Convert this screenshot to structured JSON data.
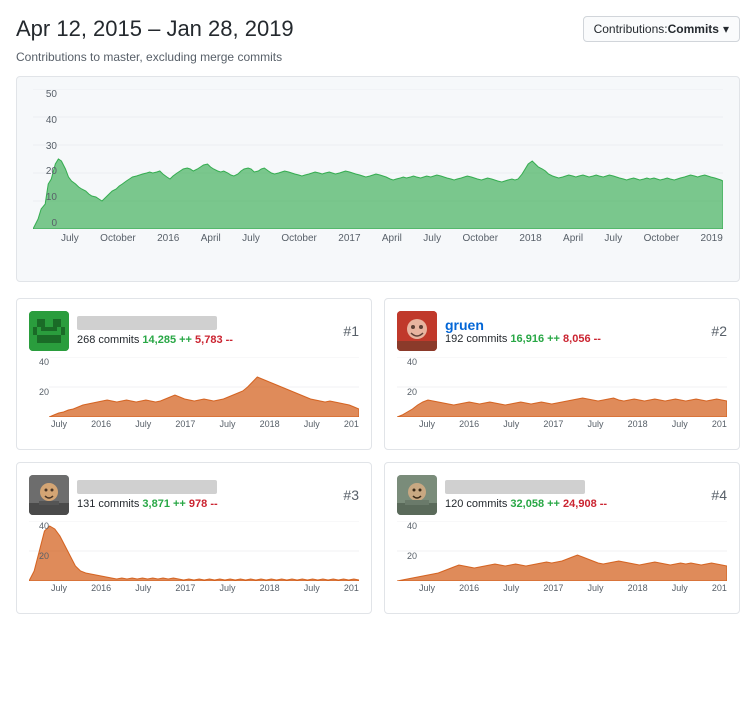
{
  "header": {
    "date_range": "Apr 12, 2015 – Jan 28, 2019",
    "contributions_label": "Contributions: ",
    "contributions_type": "Commits",
    "caret": "▾"
  },
  "subtitle": "Contributions to master, excluding merge commits",
  "main_chart": {
    "y_labels": [
      "50",
      "40",
      "30",
      "20",
      "10",
      "0"
    ],
    "x_labels": [
      "July",
      "October",
      "2016",
      "April",
      "July",
      "October",
      "2017",
      "April",
      "July",
      "October",
      "2018",
      "April",
      "July",
      "October",
      "2019"
    ]
  },
  "contributors": [
    {
      "rank": "#1",
      "name_hidden": true,
      "name": "",
      "commits": "268 commits",
      "additions": "14,285 ++",
      "deletions": "5,783 --",
      "x_labels": [
        "July",
        "2016",
        "July",
        "2017",
        "July",
        "2018",
        "July",
        "201"
      ],
      "avatar_type": "green-pixel"
    },
    {
      "rank": "#2",
      "name_hidden": false,
      "name": "gruen",
      "commits": "192 commits",
      "additions": "16,916 ++",
      "deletions": "8,056 --",
      "x_labels": [
        "July",
        "2016",
        "July",
        "2017",
        "July",
        "2018",
        "July",
        "201"
      ],
      "avatar_type": "red-face"
    },
    {
      "rank": "#3",
      "name_hidden": true,
      "name": "",
      "commits": "131 commits",
      "additions": "3,871 ++",
      "deletions": "978 --",
      "x_labels": [
        "July",
        "2016",
        "July",
        "2017",
        "July",
        "2018",
        "July",
        "201"
      ],
      "avatar_type": "face-1"
    },
    {
      "rank": "#4",
      "name_hidden": true,
      "name": "",
      "commits": "120 commits",
      "additions": "32,058 ++",
      "deletions": "24,908 --",
      "x_labels": [
        "July",
        "2016",
        "July",
        "2017",
        "July",
        "2018",
        "July",
        "201"
      ],
      "avatar_type": "face-2"
    }
  ]
}
